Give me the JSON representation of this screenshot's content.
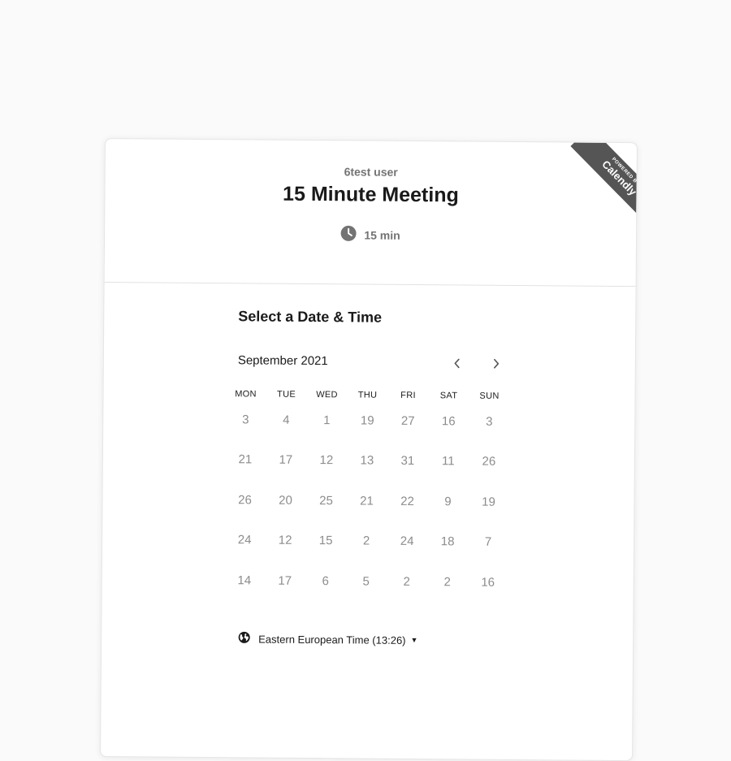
{
  "header": {
    "organizer": "6test user",
    "event_title": "15 Minute Meeting",
    "duration": "15 min",
    "duration_icon": "clock-icon"
  },
  "ribbon": {
    "powered_by": "POWERED BY",
    "brand": "Calendly",
    "color": "#555555"
  },
  "calendar": {
    "section_title": "Select a Date & Time",
    "month": "September 2021",
    "prev_icon": "chevron-left-icon",
    "next_icon": "chevron-right-icon",
    "day_headers": [
      "MON",
      "TUE",
      "WED",
      "THU",
      "FRI",
      "SAT",
      "SUN"
    ],
    "weeks": [
      [
        "3",
        "4",
        "1",
        "19",
        "27",
        "16",
        "3"
      ],
      [
        "21",
        "17",
        "12",
        "13",
        "31",
        "11",
        "26"
      ],
      [
        "26",
        "20",
        "25",
        "21",
        "22",
        "9",
        "19"
      ],
      [
        "24",
        "12",
        "15",
        "2",
        "24",
        "18",
        "7"
      ],
      [
        "14",
        "17",
        "6",
        "5",
        "2",
        "2",
        "16"
      ]
    ]
  },
  "timezone": {
    "icon": "globe-icon",
    "label": "Eastern European Time (13:26)"
  }
}
